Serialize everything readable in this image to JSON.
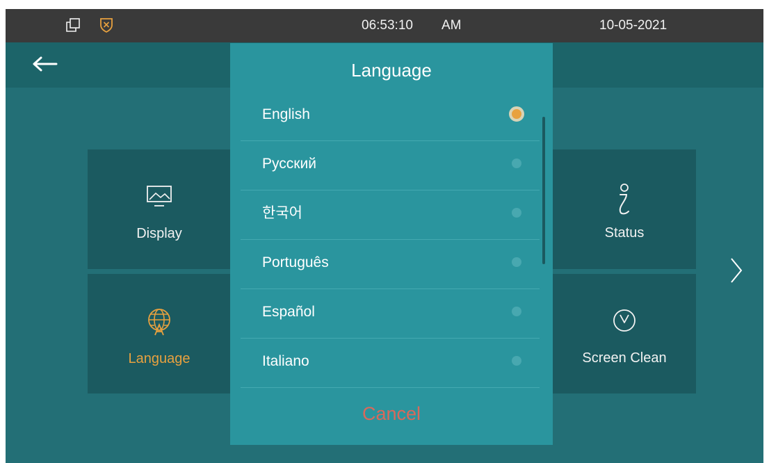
{
  "status_bar": {
    "time": "06:53:10",
    "ampm": "AM",
    "date": "10-05-2021",
    "icons": [
      "copy-icon",
      "shield-x-icon"
    ]
  },
  "header": {
    "back_icon": "arrow-left-icon"
  },
  "tiles": [
    {
      "label": "Display",
      "icon": "monitor-icon",
      "active": false
    },
    {
      "label": "Language",
      "icon": "globe-language-icon",
      "active": true
    },
    {
      "label": "Status",
      "icon": "info-icon",
      "active": false
    },
    {
      "label": "Screen Clean",
      "icon": "timer-icon",
      "active": false
    }
  ],
  "next_icon": "chevron-right-icon",
  "dialog": {
    "title": "Language",
    "languages": [
      {
        "label": "English",
        "selected": true
      },
      {
        "label": "Русский",
        "selected": false
      },
      {
        "label": "한국어",
        "selected": false
      },
      {
        "label": "Português",
        "selected": false
      },
      {
        "label": "Español",
        "selected": false
      },
      {
        "label": "Italiano",
        "selected": false
      }
    ],
    "cancel_label": "Cancel"
  },
  "colors": {
    "background": "#236f76",
    "header": "#1c6469",
    "tile": "#1b5a60",
    "dialog": "#2a959e",
    "status_bar": "#3a3a3a",
    "accent": "#e8a13f",
    "cancel": "#d9695b"
  }
}
